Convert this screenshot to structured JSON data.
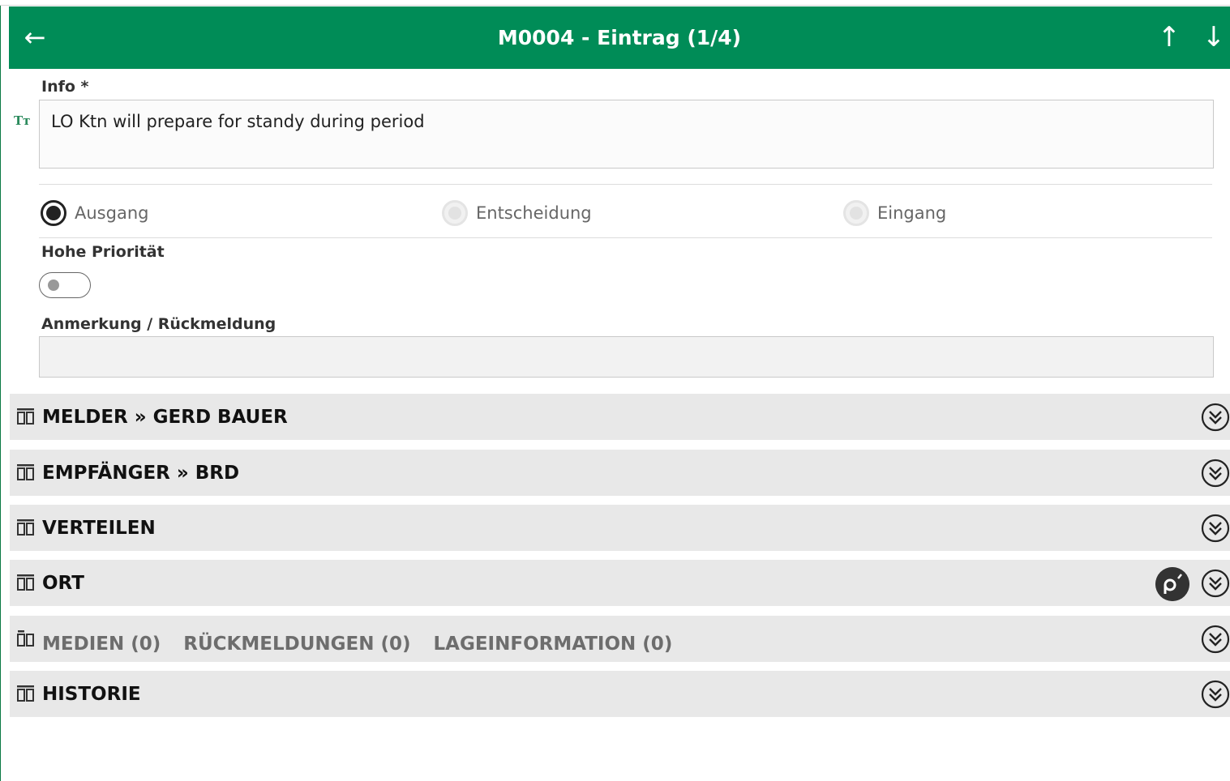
{
  "header": {
    "title": "M0004 - Eintrag  (1/4)"
  },
  "info": {
    "label": "Info *",
    "value": "LO Ktn will prepare for standy during period",
    "format_icon_text": "Tт"
  },
  "direction": {
    "options": [
      {
        "label": "Ausgang",
        "checked": true,
        "enabled": true
      },
      {
        "label": "Entscheidung",
        "checked": false,
        "enabled": false
      },
      {
        "label": "Eingang",
        "checked": false,
        "enabled": false
      }
    ]
  },
  "priority": {
    "label": "Hohe Priorität",
    "on": false
  },
  "remark": {
    "label": "Anmerkung / Rückmeldung",
    "value": ""
  },
  "sections": [
    {
      "title": "MELDER » GERD BAUER"
    },
    {
      "title": "EMPFÄNGER » BRD"
    },
    {
      "title": "VERTEILEN"
    },
    {
      "title": "ORT"
    },
    {
      "tabs": [
        "MEDIEN (0)",
        "RÜCKMELDUNGEN (0)",
        "LAGEINFORMATION (0)"
      ]
    },
    {
      "title": "HISTORIE"
    }
  ],
  "colors": {
    "header_bg": "#008c57",
    "section_bg": "#e8e8e8"
  }
}
